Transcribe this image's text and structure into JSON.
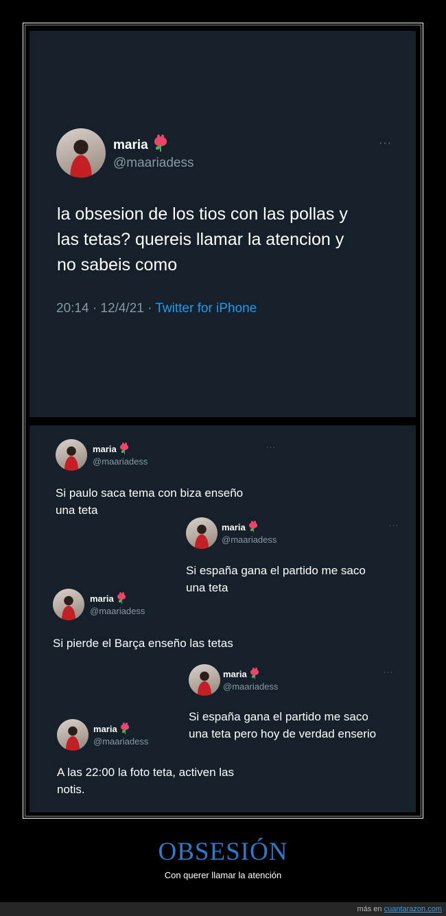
{
  "main_tweet": {
    "name": "maria",
    "handle": "@maariadess",
    "text_lines": [
      "la obsesion de los tios con las pollas y",
      "las tetas? quereis llamar la atencion y",
      "no sabeis como"
    ],
    "meta_time": "20:14 · 12/4/21 · ",
    "meta_source": "Twitter for iPhone",
    "more_label": "···"
  },
  "tweets": [
    {
      "name": "maria",
      "handle": "@maariadess",
      "text_lines": [
        "Si paulo saca tema con biza enseño",
        "una teta"
      ],
      "more_label": "···"
    },
    {
      "name": "maria",
      "handle": "@maariadess",
      "text_lines": [
        "Si españa gana el partido me saco",
        "una teta"
      ],
      "more_label": "···"
    },
    {
      "name": "maria",
      "handle": "@maariadess",
      "text_lines": [
        "Si pierde el Barça enseño las tetas"
      ]
    },
    {
      "name": "maria",
      "handle": "@maariadess",
      "text_lines": [
        "Si españa gana el partido me saco",
        "una teta pero hoy de verdad enserio"
      ],
      "more_label": "···"
    },
    {
      "name": "maria",
      "handle": "@maariadess",
      "text_lines": [
        "A las 22:00 la foto teta, activen las",
        "notis."
      ]
    }
  ],
  "caption": {
    "title": "OBSESIÓN",
    "subtitle": "Con querer llamar la atención"
  },
  "footer": {
    "prefix": "más en ",
    "site": "cuantarazon.com"
  },
  "colors": {
    "background": "#000000",
    "tweet_background": "#15202b",
    "link_blue": "#1d9bf0",
    "handle_grey": "#8899a6",
    "caption_blue": "#2e7ac7",
    "footer_link": "#3b9be3"
  },
  "icons": [
    "tulip-emoji-icon",
    "more-options-icon",
    "avatar"
  ]
}
